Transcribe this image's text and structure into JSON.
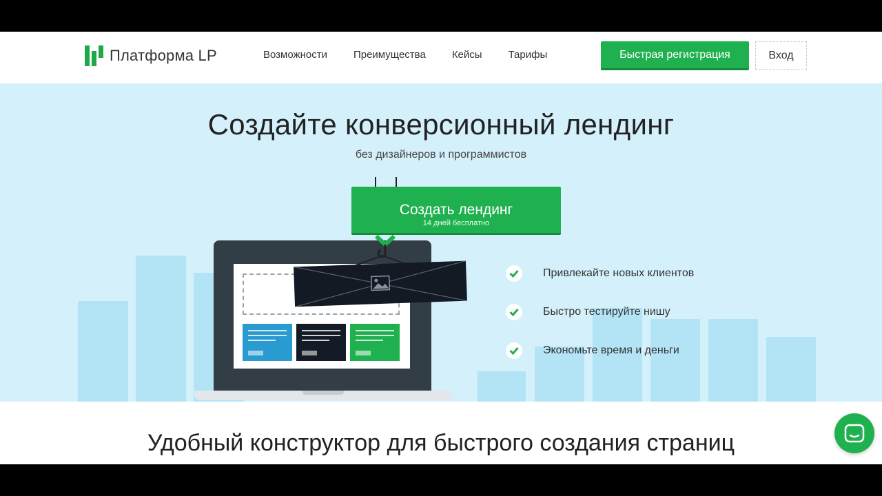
{
  "header": {
    "logo_text": "Платформа LP",
    "nav": [
      "Возможности",
      "Преимущества",
      "Кейсы",
      "Тарифы"
    ],
    "register_label": "Быстрая регистрация",
    "login_label": "Вход"
  },
  "hero": {
    "title": "Создайте конверсионный лендинг",
    "subtitle": "без дизайнеров и программистов",
    "cta_label": "Создать лендинг",
    "cta_sublabel": "14 дней бесплатно",
    "features": [
      "Привлекайте новых клиентов",
      "Быстро тестируйте нишу",
      "Экономьте время и деньги"
    ]
  },
  "section": {
    "title": "Удобный конструктор для быстрого создания страниц"
  },
  "colors": {
    "accent": "#1fb14f",
    "hero_bg": "#d4f0fa",
    "bars": "#b3e4f6"
  },
  "icons": {
    "logo": "logo-bars-icon",
    "feature": "check-icon",
    "chat": "chat-icon",
    "banner": "image-placeholder-icon"
  }
}
